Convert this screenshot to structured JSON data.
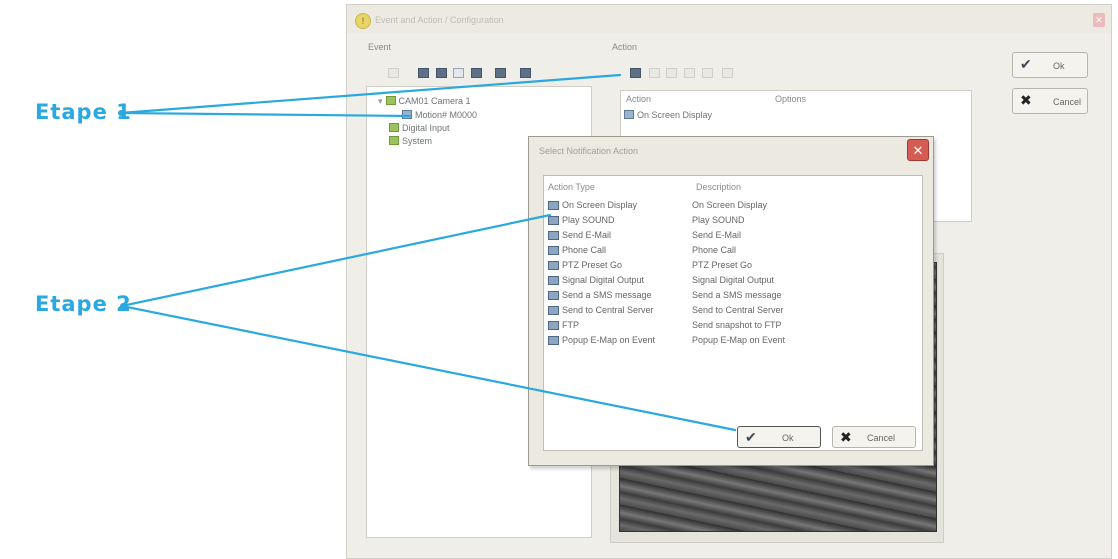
{
  "annotations": {
    "step1": "Etape 1",
    "step2": "Etape 2"
  },
  "main_window": {
    "title": "Event and Action / Configuration",
    "event_group_label": "Event",
    "action_group_label": "Action",
    "event_tree": [
      {
        "label": "CAM01 Camera 1",
        "icon": "camera-icon"
      },
      {
        "label": "Motion# M0000",
        "icon": "motion-icon"
      },
      {
        "label": "Digital Input",
        "icon": "digital-input-icon"
      },
      {
        "label": "System",
        "icon": "system-icon"
      }
    ],
    "action_columns": {
      "action": "Action",
      "options": "Options"
    },
    "action_rows": [
      {
        "action": "On Screen Display",
        "options": ""
      }
    ],
    "ok_label": "Ok",
    "cancel_label": "Cancel"
  },
  "dialog": {
    "title": "Select Notification Action",
    "columns": {
      "type": "Action Type",
      "description": "Description"
    },
    "rows": [
      {
        "type": "On Screen Display",
        "description": "On Screen Display"
      },
      {
        "type": "Play SOUND",
        "description": "Play SOUND"
      },
      {
        "type": "Send E-Mail",
        "description": "Send E-Mail"
      },
      {
        "type": "Phone Call",
        "description": "Phone Call"
      },
      {
        "type": "PTZ Preset Go",
        "description": "PTZ Preset Go"
      },
      {
        "type": "Signal Digital Output",
        "description": "Signal Digital Output"
      },
      {
        "type": "Send a SMS message",
        "description": "Send a SMS message"
      },
      {
        "type": "Send to Central Server",
        "description": "Send to Central Server"
      },
      {
        "type": "FTP",
        "description": "Send snapshot to FTP"
      },
      {
        "type": "Popup E-Map on Event",
        "description": "Popup E-Map on Event"
      }
    ],
    "ok_label": "Ok",
    "cancel_label": "Cancel"
  },
  "colors": {
    "annotation": "#2aa8e0",
    "dialog_close": "#d45c53"
  }
}
